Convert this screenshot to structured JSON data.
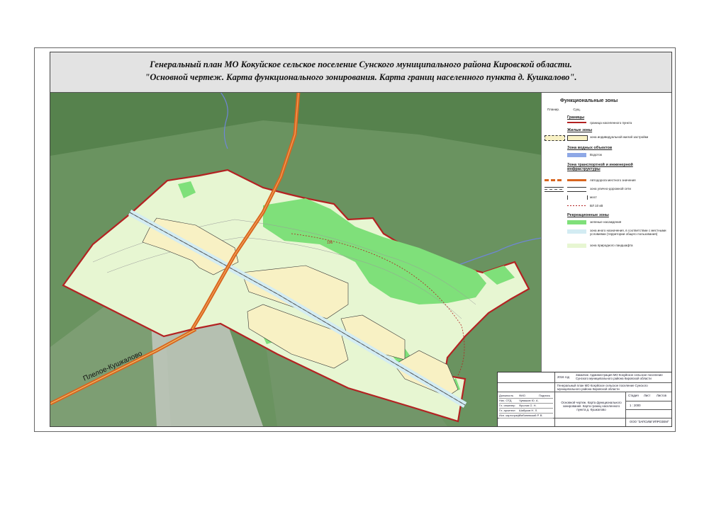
{
  "title": {
    "line1": "Генеральный план МО Кокуйское сельское поселение Сунского муниципального района Кировской области.",
    "line2": "\"Основной чертеж. Карта функционального зонирования. Карта границ населенного пункта д. Кушкалово\"."
  },
  "map": {
    "road_label": "Плелое-Кушкалово",
    "contour_label": "196"
  },
  "legend": {
    "title": "Функциональные зоны",
    "col_plan": "Планир.",
    "col_exist": "Сущ.",
    "sections": {
      "borders": "Границы",
      "living": "Жилые зоны",
      "water": "Зона водных объектов",
      "transport": "Зона транспортной и инженерной инфраструктуры",
      "recreation": "Рекреационные зоны"
    },
    "items": {
      "settlement_border": "граница населенного пункта",
      "individual_housing": "зона индивидуальной жилой застройки",
      "water_body": "Водоток",
      "local_road": "Автодорога местного значения",
      "street_network": "зона улично-дорожной сети",
      "bridge": "мост",
      "power_line": "ВЛ 10 кВ",
      "green_plantings": "зеленые насаждения",
      "other_purpose": "зона иного назначения, в соответствии с местными условиями (территории общего пользования)",
      "natural_landscape": "зона природного ландшафта"
    }
  },
  "stamp": {
    "year": "2016 год",
    "customer": "Заказчик: Администрация МО Кокуйское сельское поселение Сунского муниципального района Кировской области",
    "project": "Генеральный план МО Кокуйское сельское поселение Сунского муниципального района Кировской области",
    "sheet_title": "Основной чертеж. Карта функционального зонирования. Карта границ населенного пункта д. Кушкалово",
    "company": "ООО \"ЗАПСИБГИПРОЗЕМ\"",
    "stage_label": "Стадия",
    "sheet_label": "Лист",
    "sheets_label": "Листов",
    "scale": "1 : 2000",
    "rows": [
      {
        "role": "Должность",
        "name": "ФИО",
        "sign": "Подпись"
      },
      {
        "role": "Нач. ОТД",
        "name": "Чувашов Ю. А.",
        "sign": ""
      },
      {
        "role": "Гл. инженер",
        "name": "Фролов О. Н.",
        "sign": ""
      },
      {
        "role": "Гл. архитект.",
        "name": "Шабуков Н. Л.",
        "sign": ""
      },
      {
        "role": "Исп. картограф",
        "name": "Фибиневский Р. В.",
        "sign": ""
      }
    ]
  },
  "colors": {
    "border": "#b32222",
    "housing": "#f8f1c4",
    "greenery": "#7fe07a",
    "landscape": "#e7f6d2",
    "road": "#d8661f",
    "water": "#6f86d8",
    "other_purpose": "#d3ecf3",
    "sheet_background": "#e3e3e3"
  }
}
